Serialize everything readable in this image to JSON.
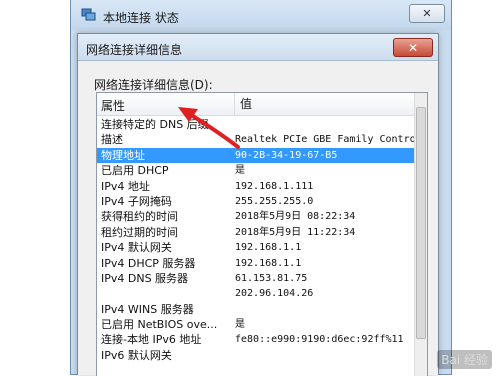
{
  "outer_window": {
    "title": "本地连接 状态",
    "close_glyph": "✕"
  },
  "dialog": {
    "title": "网络连接详细信息",
    "close_glyph": "✕",
    "list_label": "网络连接详细信息(D):",
    "columns": {
      "property": "属性",
      "value": "值"
    },
    "rows": [
      {
        "property": "连接特定的 DNS 后缀",
        "value": ""
      },
      {
        "property": "描述",
        "value": "Realtek PCIe GBE Family Contro"
      },
      {
        "property": "物理地址",
        "value": "90-2B-34-19-67-B5",
        "selected": true
      },
      {
        "property": "已启用 DHCP",
        "value": "是"
      },
      {
        "property": "IPv4 地址",
        "value": "192.168.1.111"
      },
      {
        "property": "IPv4 子网掩码",
        "value": "255.255.255.0"
      },
      {
        "property": "获得租约的时间",
        "value": "2018年5月9日 08:22:34"
      },
      {
        "property": "租约过期的时间",
        "value": "2018年5月9日 11:22:34"
      },
      {
        "property": "IPv4 默认网关",
        "value": "192.168.1.1"
      },
      {
        "property": "IPv4 DHCP 服务器",
        "value": "192.168.1.1"
      },
      {
        "property": "IPv4 DNS 服务器",
        "value": "61.153.81.75"
      },
      {
        "property": "",
        "value": "202.96.104.26"
      },
      {
        "property": "IPv4 WINS 服务器",
        "value": ""
      },
      {
        "property": "已启用 NetBIOS ove...",
        "value": "是"
      },
      {
        "property": "连接-本地 IPv6 地址",
        "value": "fe80::e990:9190:d6ec:92ff%11"
      },
      {
        "property": "IPv6 默认网关",
        "value": ""
      }
    ]
  },
  "colors": {
    "selection": "#3399ff",
    "arrow": "#e02020"
  },
  "watermark": {
    "text": "Bai 经验"
  }
}
